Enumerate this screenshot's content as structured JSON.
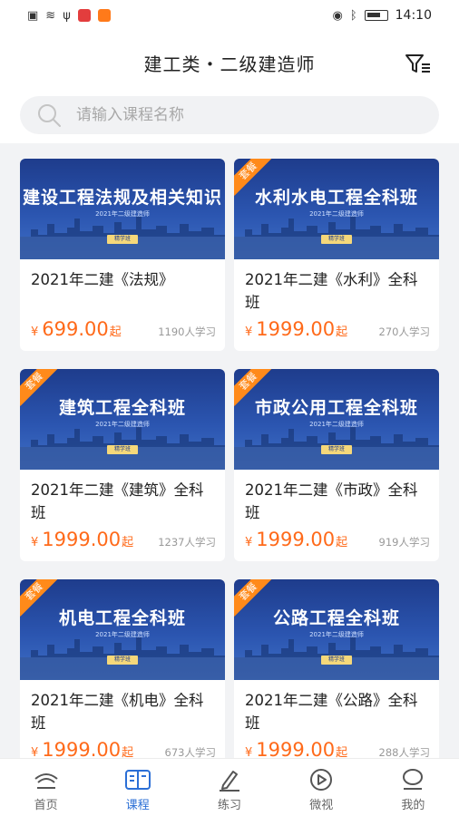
{
  "status_bar": {
    "time": "14:10"
  },
  "header": {
    "title": "建工类・二级建造师"
  },
  "search": {
    "placeholder": "请输入课程名称"
  },
  "colors": {
    "accent": "#2b6fd6",
    "price": "#ff6a1a",
    "ribbon": "#ff8a1a"
  },
  "courses": [
    {
      "banner_title": "建设工程法规及相关知识",
      "banner_sub": "2021年二级建造师",
      "banner_tag": "精学班",
      "ribbon": "",
      "title": "2021年二建《法规》",
      "price_symbol": "¥",
      "price": "699.00",
      "price_suffix": "起",
      "learners": "1190人学习"
    },
    {
      "banner_title": "水利水电工程全科班",
      "banner_sub": "2021年二级建造师",
      "banner_tag": "精学班",
      "ribbon": "套餐",
      "title": "2021年二建《水利》全科班",
      "price_symbol": "¥",
      "price": "1999.00",
      "price_suffix": "起",
      "learners": "270人学习"
    },
    {
      "banner_title": "建筑工程全科班",
      "banner_sub": "2021年二级建造师",
      "banner_tag": "精学班",
      "ribbon": "套餐",
      "title": "2021年二建《建筑》全科班",
      "price_symbol": "¥",
      "price": "1999.00",
      "price_suffix": "起",
      "learners": "1237人学习"
    },
    {
      "banner_title": "市政公用工程全科班",
      "banner_sub": "2021年二级建造师",
      "banner_tag": "精学班",
      "ribbon": "套餐",
      "title": "2021年二建《市政》全科班",
      "price_symbol": "¥",
      "price": "1999.00",
      "price_suffix": "起",
      "learners": "919人学习"
    },
    {
      "banner_title": "机电工程全科班",
      "banner_sub": "2021年二级建造师",
      "banner_tag": "精学班",
      "ribbon": "套餐",
      "title": "2021年二建《机电》全科班",
      "price_symbol": "¥",
      "price": "1999.00",
      "price_suffix": "起",
      "learners": "673人学习"
    },
    {
      "banner_title": "公路工程全科班",
      "banner_sub": "2021年二级建造师",
      "banner_tag": "精学班",
      "ribbon": "套餐",
      "title": "2021年二建《公路》全科班",
      "price_symbol": "¥",
      "price": "1999.00",
      "price_suffix": "起",
      "learners": "288人学习"
    }
  ],
  "tabbar": {
    "items": [
      {
        "label": "首页",
        "icon": "home-icon",
        "active": false
      },
      {
        "label": "课程",
        "icon": "book-icon",
        "active": true
      },
      {
        "label": "练习",
        "icon": "pen-icon",
        "active": false
      },
      {
        "label": "微视",
        "icon": "play-icon",
        "active": false
      },
      {
        "label": "我的",
        "icon": "profile-icon",
        "active": false
      }
    ]
  }
}
